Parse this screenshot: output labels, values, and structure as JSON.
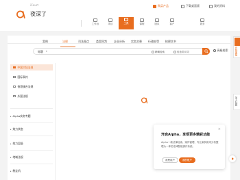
{
  "colors": {
    "accent": "#e86d1f"
  },
  "header": {
    "subtitle": "iCourt",
    "app_name": "夜深了",
    "nav": [
      {
        "label": "工作台",
        "icon": "desk-icon"
      },
      {
        "label": "项目",
        "icon": "project-icon"
      },
      {
        "label": "工具",
        "icon": "tool-icon",
        "active": true
      },
      {
        "label": "课程",
        "icon": "course-icon"
      },
      {
        "label": "团队",
        "icon": "team-icon"
      },
      {
        "label": "客户",
        "icon": "client-icon"
      },
      {
        "label": "更多",
        "icon": "more-icon"
      }
    ],
    "links": {
      "buy": "购买产品",
      "desktop": "下载桌面版",
      "profile": "我的资料"
    }
  },
  "tabs": [
    "案例",
    "法规",
    "司法观点",
    "类案同判",
    "企业分析",
    "实务文章",
    "行政处罚",
    "检察文书"
  ],
  "search": {
    "scope_label": "标题",
    "placeholder": "",
    "option1": "精确检索",
    "option2": "包含同义词",
    "advanced": "高级检索"
  },
  "sidebar": {
    "items": [
      {
        "label": "中国大陆法规",
        "active": true
      },
      {
        "label": "国际条约"
      },
      {
        "label": "香港澳台法规"
      },
      {
        "label": "外国法规"
      }
    ],
    "groups": [
      {
        "label": "Alpha实务专题"
      },
      {
        "label": "效力状态"
      },
      {
        "label": "效力层级"
      },
      {
        "label": "地域法规"
      },
      {
        "label": "制定机"
      }
    ]
  },
  "popup": {
    "title": "开启Alpha，享受更多精彩功能",
    "desc": "Alpha一款法律检索、案件管理、专业案例用来分析整理为一体的法律智能操作系统。",
    "close": "×",
    "btn_secondary": "我是用户",
    "btn_primary": "我的账户"
  },
  "rightfloat": {
    "tab1": "在线客服",
    "tab2": "加入社群"
  }
}
